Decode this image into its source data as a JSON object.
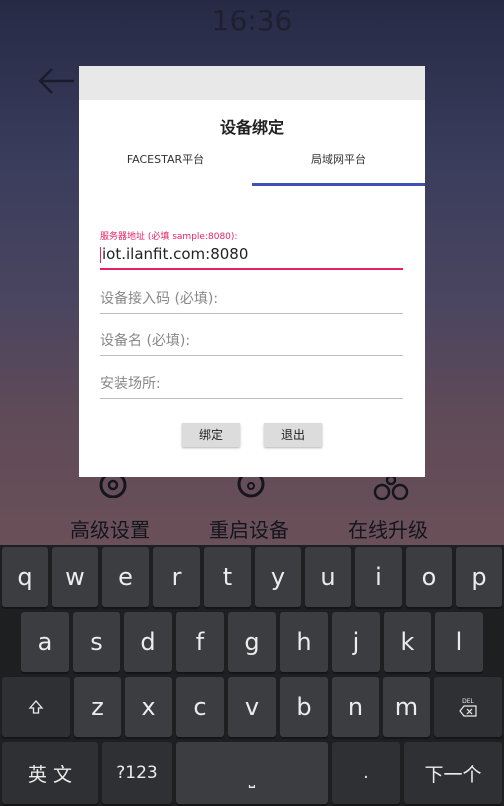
{
  "status": {
    "time": "16:36"
  },
  "background": {
    "labels": [
      "高级设置",
      "重启设备",
      "在线升级"
    ]
  },
  "dialog": {
    "title": "设备绑定",
    "tabs": [
      {
        "label": "FACESTAR平台"
      },
      {
        "label": "局域网平台"
      }
    ],
    "fields": {
      "server": {
        "label": "服务器地址 (必填 sample:8080):",
        "value": "iot.ilanfit.com:8080"
      },
      "access_code": {
        "placeholder": "设备接入码 (必填):"
      },
      "device_name": {
        "placeholder": "设备名 (必填):"
      },
      "location": {
        "placeholder": "安装场所:"
      }
    },
    "buttons": {
      "bind": "绑定",
      "exit": "退出"
    }
  },
  "keyboard": {
    "row1": [
      "q",
      "w",
      "e",
      "r",
      "t",
      "y",
      "u",
      "i",
      "o",
      "p"
    ],
    "row2": [
      "a",
      "s",
      "d",
      "f",
      "g",
      "h",
      "j",
      "k",
      "l"
    ],
    "row3": [
      "z",
      "x",
      "c",
      "v",
      "b",
      "n",
      "m"
    ],
    "lang": "英 文",
    "symbols": "?123",
    "space": "⎵",
    "period": ".",
    "next": "下一个",
    "del_small": "DEL"
  },
  "colors": {
    "accent": "#3f51b5",
    "error_pink": "#e91e63"
  }
}
